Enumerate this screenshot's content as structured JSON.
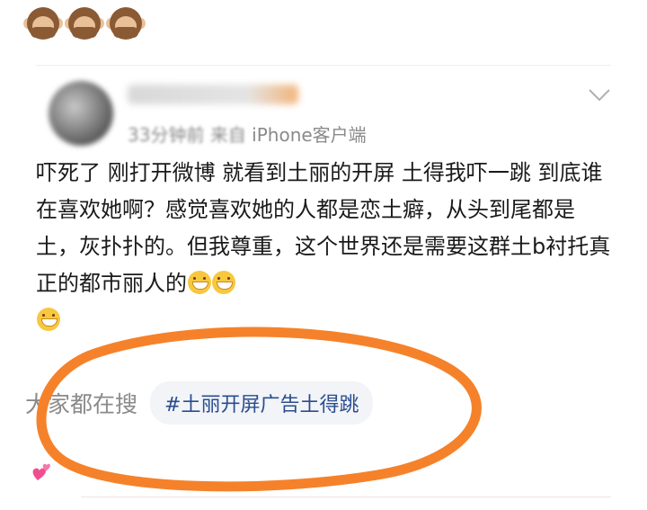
{
  "header": {
    "emojis": [
      "see-no-evil-monkey",
      "see-no-evil-monkey",
      "see-no-evil-monkey"
    ]
  },
  "post": {
    "time_prefix": "33分钟前",
    "source": "来自",
    "client": "iPhone客户端",
    "content": "吓死了 刚打开微博 就看到土丽的开屏 土得我吓一跳 到底谁在喜欢她啊？感觉喜欢她的人都是恋土癖，从头到尾都是土，灰扑扑的。但我尊重，这个世界还是需要这群土b衬托真正的都市丽人的"
  },
  "search": {
    "label": "大家都在搜",
    "topic": "#土丽开屏广告土得跳"
  },
  "colors": {
    "highlight": "#f5822a",
    "topic_text": "#2a4d8f",
    "chip_bg": "#f2f4f7"
  }
}
